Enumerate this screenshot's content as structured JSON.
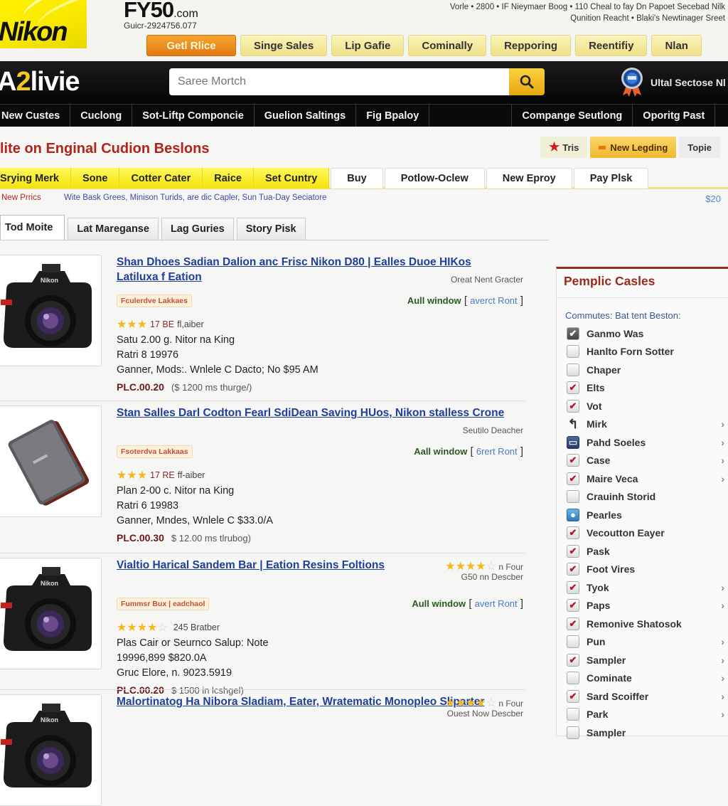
{
  "header": {
    "logo": "Nikon",
    "site_name": "FY50",
    "site_suffix": ".com",
    "phone": "Guicr-2924756.077",
    "info_line1": "Vorle • 2800 • IF Nieymaer Boog • 110 Cheal to fay Dn Papoet Secebad Nilk",
    "info_line2": "Qunition Reacht • Blaki's Newtinager Sreet",
    "tabs": [
      {
        "label": "Getl Rlice",
        "active": true
      },
      {
        "label": "Singe Sales",
        "active": false
      },
      {
        "label": "Lip Gafie",
        "active": false
      },
      {
        "label": "Cominally",
        "active": false
      },
      {
        "label": "Repporing",
        "active": false
      },
      {
        "label": "Reentifiy",
        "active": false
      },
      {
        "label": "Nlan",
        "active": false
      }
    ]
  },
  "blackbar": {
    "brand_prefix": "A",
    "brand_digit": "2",
    "brand_suffix": "livie",
    "search_placeholder": "Saree Mortch",
    "search_icon": "search-icon",
    "badge_text": "Ultal Sectose Nl"
  },
  "nav": {
    "items_left": [
      "New Custes",
      "Cuclong",
      "Sot-Liftp Componcie",
      "Guelion Saltings",
      "Fig Bpaloy"
    ],
    "items_right": [
      "Compange Seutlong",
      "Oporitg Past"
    ]
  },
  "headline": "lite on Enginal Cudion Beslons",
  "quick_buttons": [
    {
      "label": "Tris",
      "icon": "star-icon"
    },
    {
      "label": "New Legding",
      "icon": "flag-icon"
    },
    {
      "label": "Topie",
      "icon": ""
    }
  ],
  "category_tabs": {
    "highlighted": [
      "Srying Merk",
      "Sone",
      "Cotter Cater",
      "Raice",
      "Set Cuntry"
    ],
    "plain": [
      "Buy",
      "Potlow-Oclew",
      "New Eproy",
      "Pay Plsk"
    ]
  },
  "promo": {
    "label": "New Prrics",
    "text": "Wite Bask Grees, Minison Turids, are dic Capler, Sun Tua-Day Seciatore",
    "price": "$20"
  },
  "sub_tabs": [
    {
      "label": "Tod Moite",
      "active": true
    },
    {
      "label": "Lat Mareganse",
      "active": false
    },
    {
      "label": "Lag Guries",
      "active": false
    },
    {
      "label": "Story Pisk",
      "active": false
    }
  ],
  "listings": [
    {
      "title": "Shan Dhoes Sadian Dalion anc Frisc Nikon D80 | Ealles Duoe HIKos Latiluxa f Eation",
      "seller": "Oreat Nent Gracter",
      "tag": "Fculerdve Lakkaes",
      "window_label": "Aull window",
      "window_link": "averct Ront",
      "rating": 3,
      "rating_max": 3,
      "rating_count": "17 BE",
      "rating_suffix": "fl,aiber",
      "line1": "Satu 2.00 g. Nitor na King",
      "line2": "Ratri 8 19976",
      "line3": "Ganner, Mods:. Wnlele C Dacto; No $95 AM",
      "price": "PLC.00.20",
      "price_note": "($ 1200 ms thurge/)",
      "image": "camera"
    },
    {
      "title": "Stan Salles Darl Codton Fearl SdiDean Saving HUos, Nikon stalless Crone",
      "seller": "Seutilo Deacher",
      "tag": "Fsoterdva Lakkaas",
      "window_label": "Aall window",
      "window_link": "6rert Ront",
      "rating": 3,
      "rating_max": 3,
      "rating_count": "17 RE",
      "rating_suffix": "ff-aiber",
      "line1": "Plan 2-00 c. Nitor na King",
      "line2": "Ratri 6 19983",
      "line3": "Ganner, Mndes, Wnlele C $33.0/A",
      "price": "PLC.00.30",
      "price_note": "$ 12.00 ms tlrubog)",
      "image": "drive"
    },
    {
      "title": "Vialtio Harical Sandem Bar | Eation Resins Foltions",
      "seller": "G50 nn Descber",
      "top_rating": 4,
      "top_rating_label": "n Four",
      "tag": "Fummsr Bux | eadchaol",
      "window_label": "Aull window",
      "window_link": "avert Ront",
      "rating": 4,
      "rating_max": 5,
      "rating_count": "",
      "rating_suffix": "245 Bratber",
      "line1": "Plas Cair or Seurnco Salup: Note",
      "line2": "19996,899 $820.0A",
      "line3": "Gruc Elore, n. 9023.5919",
      "price": "PLC.00.20",
      "price_note": "$ 1500 in lcshgel)",
      "image": "camera"
    },
    {
      "title": "Malortinatog Ha Nibora Sladiam, Eater, Wratematic Monopleo Sliparter",
      "seller": "Ouest Now Descber",
      "top_rating": 4,
      "top_rating_label": "n Four",
      "image": "camera"
    }
  ],
  "sidebar": {
    "title": "Pemplic Casles",
    "subtitle": "Commutes: Bat tent Beston:",
    "items": [
      {
        "label": "Ganmo Was",
        "state": "dark",
        "chevron": false
      },
      {
        "label": "Hanlto Forn Sotter",
        "state": "empty",
        "chevron": false
      },
      {
        "label": "Chaper",
        "state": "empty",
        "chevron": false
      },
      {
        "label": "Elts",
        "state": "checked",
        "chevron": false
      },
      {
        "label": "Vot",
        "state": "checked",
        "chevron": false
      },
      {
        "label": "Mirk",
        "state": "hook",
        "chevron": true
      },
      {
        "label": "Pahd Soeles",
        "state": "navy",
        "chevron": true
      },
      {
        "label": "Case",
        "state": "checked",
        "chevron": true
      },
      {
        "label": "Maire Veca",
        "state": "checked",
        "chevron": true
      },
      {
        "label": "Crauinh Storid",
        "state": "empty",
        "chevron": false
      },
      {
        "label": "Pearles",
        "state": "blue",
        "chevron": false
      },
      {
        "label": "Vecoutton Eayer",
        "state": "checked",
        "chevron": false
      },
      {
        "label": "Pask",
        "state": "checked",
        "chevron": false
      },
      {
        "label": "Foot Vires",
        "state": "checked",
        "chevron": false
      },
      {
        "label": "Tyok",
        "state": "checked",
        "chevron": true
      },
      {
        "label": "Paps",
        "state": "checked",
        "chevron": true
      },
      {
        "label": "Remonive Shatosok",
        "state": "checked",
        "chevron": false
      },
      {
        "label": "Pun",
        "state": "empty",
        "chevron": true
      },
      {
        "label": "Sampler",
        "state": "checked",
        "chevron": true
      },
      {
        "label": "Cominate",
        "state": "empty",
        "chevron": true
      },
      {
        "label": "Sard Scoiffer",
        "state": "checked",
        "chevron": true
      },
      {
        "label": "Park",
        "state": "empty",
        "chevron": true
      },
      {
        "label": "Sampler",
        "state": "empty",
        "chevron": false
      }
    ]
  },
  "colors": {
    "accent_red": "#b2231a",
    "link_blue": "#1f3f9c",
    "yellow": "#f4e40a",
    "orange": "#e07a10",
    "star": "#f4b81c"
  }
}
